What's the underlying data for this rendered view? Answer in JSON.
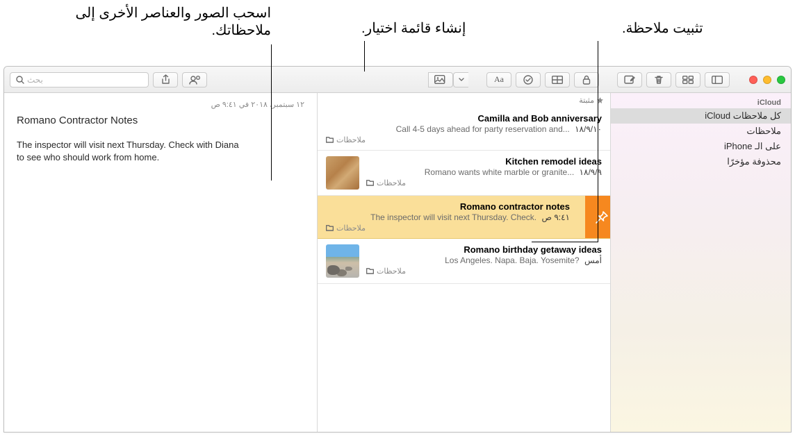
{
  "callouts": {
    "drag": "اسحب الصور والعناصر الأخرى إلى ملاحظاتك.",
    "checklist": "إنشاء قائمة اختيار.",
    "pin": "تثبيت ملاحظة."
  },
  "toolbar": {
    "search_placeholder": "بحث"
  },
  "sidebar": {
    "head": "iCloud",
    "items": [
      {
        "label": "كل ملاحظات iCloud",
        "selected": true
      },
      {
        "label": "ملاحظات",
        "selected": false
      },
      {
        "label": "على الـ iPhone",
        "selected": false
      },
      {
        "label": "محذوفة مؤخرًا",
        "selected": false
      }
    ]
  },
  "notelist": {
    "pinned_label": "مثبتة",
    "folder_label": "ملاحظات",
    "items": [
      {
        "title": "Camilla and Bob anniversary",
        "date": "١٨/٩/١٠",
        "snippet": "Call 4-5 days ahead for party reservation and...",
        "thumb": null,
        "selected": false
      },
      {
        "title": "Kitchen remodel ideas",
        "date": "١٨/٩/٩",
        "snippet": "Romano wants white marble or granite...",
        "thumb": "wood",
        "selected": false
      },
      {
        "title": "Romano contractor notes",
        "date": "٩:٤١ ص",
        "snippet": "The inspector will visit next Thursday. Check.",
        "thumb": null,
        "selected": true,
        "pinned": true
      },
      {
        "title": "Romano birthday getaway ideas",
        "date": "أمس",
        "snippet": "Los Angeles. Napa. Baja. Yosemite?",
        "thumb": "beach",
        "selected": false
      }
    ]
  },
  "editor": {
    "timestamp": "١٢ سبتمبر، ٢٠١٨ في ٩:٤١ ص",
    "title": "Romano Contractor Notes",
    "body": "The inspector will visit next Thursday. Check with Diana to see who should work from home."
  }
}
